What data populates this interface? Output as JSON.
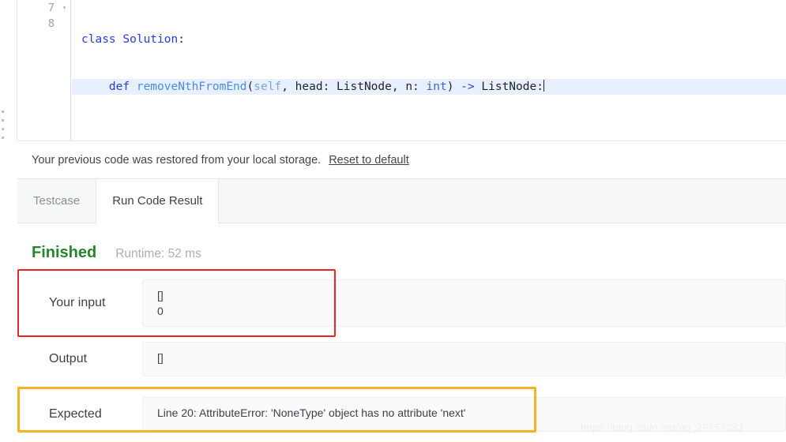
{
  "editor": {
    "lines": [
      {
        "number": "7",
        "folded_marker": "▾",
        "active": false,
        "tokens": [
          {
            "text": "class ",
            "type": "kw"
          },
          {
            "text": "Solution",
            "type": "cls"
          },
          {
            "text": ":",
            "type": "plain"
          }
        ]
      },
      {
        "number": "8",
        "folded_marker": "",
        "active": true,
        "tokens": [
          {
            "text": "    ",
            "type": "plain"
          },
          {
            "text": "def ",
            "type": "kw"
          },
          {
            "text": "removeNthFromEnd",
            "type": "fn"
          },
          {
            "text": "(",
            "type": "plain"
          },
          {
            "text": "self",
            "type": "self"
          },
          {
            "text": ", head: ListNode, n: ",
            "type": "plain"
          },
          {
            "text": "int",
            "type": "type"
          },
          {
            "text": ")",
            "type": "plain"
          },
          {
            "text": " -> ",
            "type": "op"
          },
          {
            "text": "ListNode:",
            "type": "plain"
          }
        ]
      }
    ]
  },
  "notice": {
    "message": "Your previous code was restored from your local storage.",
    "link_label": "Reset to default"
  },
  "tabs": [
    {
      "label": "Testcase",
      "active": false
    },
    {
      "label": "Run Code Result",
      "active": true
    }
  ],
  "result": {
    "status": "Finished",
    "runtime": "Runtime: 52 ms",
    "rows": [
      {
        "label": "Your input",
        "value": "[]\n0"
      },
      {
        "label": "Output",
        "value": "[]"
      },
      {
        "label": "Expected",
        "value": "Line 20: AttributeError: 'NoneType' object has no attribute 'next'"
      }
    ]
  },
  "annotations": {
    "red_color": "#e8232a",
    "orange_color": "#f6b322"
  },
  "watermark": "https://blog.csdn.net/qq_29757283"
}
